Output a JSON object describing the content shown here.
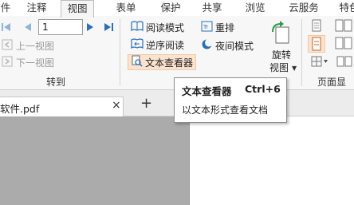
{
  "menu": {
    "tabs": [
      {
        "label": "件"
      },
      {
        "label": "注释"
      },
      {
        "label": "视图"
      },
      {
        "label": "表单"
      },
      {
        "label": "保护"
      },
      {
        "label": "共享"
      },
      {
        "label": "浏览"
      },
      {
        "label": "云服务"
      },
      {
        "label": "特色"
      }
    ]
  },
  "ribbon": {
    "goto": {
      "page_value": "1",
      "prev_view": "上一视图",
      "next_view": "下一视图",
      "group_label": "转到"
    },
    "view": {
      "reading_mode": "阅读模式",
      "reflow": "重排",
      "reverse_reading": "逆序阅读",
      "night_mode": "夜间模式",
      "text_viewer": "文本查看器",
      "rotate_line1": "旋转",
      "rotate_line2": "视图",
      "page_display_label": "页面显示"
    }
  },
  "doc_tabs": {
    "file_name": "软件.pdf",
    "close_glyph": "×",
    "add_glyph": "+"
  },
  "tooltip": {
    "title": "文本查看器",
    "shortcut": "Ctrl+6",
    "description": "以文本形式查看文档"
  },
  "colors": {
    "accent_blue": "#2b6fb6",
    "highlight": "#fbe3cf",
    "sidebar_gray": "#ababab"
  }
}
